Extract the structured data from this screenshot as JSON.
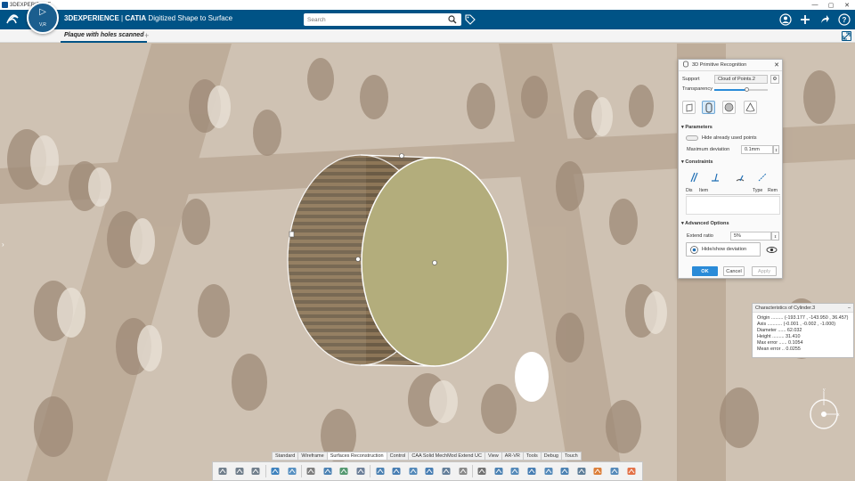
{
  "os": {
    "title": "3DEXPERIENCE",
    "controls": [
      "—",
      "▢",
      "✕"
    ]
  },
  "header": {
    "brand_bold": "3DEXPERIENCE",
    "brand_sep": " | ",
    "brand_app": "CATIA",
    "brand_role": " Digitized Shape to Surface",
    "compass_label": "V,R",
    "search_placeholder": "Search"
  },
  "tabs": {
    "active": "Plaque with holes scanned",
    "add": "+"
  },
  "panel": {
    "title": "3D Primitive Recognition",
    "support_label": "Support",
    "support_value": "Cloud of Points.2",
    "transparency_label": "Transparency",
    "transparency_value": 0.6,
    "parameters_label": "Parameters",
    "hide_used_label": "Hide already used points",
    "max_dev_label": "Maximum deviation",
    "max_dev_value": "0.1mm",
    "constraints_label": "Constraints",
    "table_headers": {
      "dis": "Dis",
      "item": "Item",
      "type": "Type",
      "rem": "Rem"
    },
    "advanced_label": "Advanced Options",
    "extend_label": "Extend ratio",
    "extend_value": "5%",
    "hide_show_label": "Hide/show deviation",
    "ok": "OK",
    "cancel": "Cancel",
    "apply": "Apply"
  },
  "characteristics": {
    "title": "Characteristics of Cylinder.3",
    "origin": "Origin ......... (-193.177 , -143.950 , 36.457)",
    "axis": "Axis ........... (-0.001 , -0.002 , -1.000)",
    "diameter": "Diameter ...... 62.032",
    "height": "Height ......... 31.410",
    "max_error": "Max error ...... 0.1054",
    "mean_error": "Mean error .. 0.0255"
  },
  "action_tabs": [
    "Standard",
    "Wireframe",
    "Surfaces Reconstruction",
    "Control",
    "CAA Solid MechMod Extend UC",
    "View",
    "AR-VR",
    "Tools",
    "Debug",
    "Touch"
  ],
  "active_action_tab": "Surfaces Reconstruction",
  "colors": {
    "header": "#005386",
    "accent": "#2a8bd8",
    "cylinder_face": "#b3ad7c"
  },
  "toolbar_icons": [
    "cut-icon",
    "copy-icon",
    "paste-icon",
    "undo-icon",
    "apply-appearance-icon",
    "settings-icon",
    "cloud-import-icon",
    "activate-icon",
    "mesh-icon",
    "scan-icon",
    "curve-icon",
    "surface-icon",
    "primitive-icon",
    "feature-recognition-icon",
    "snap-icon",
    "gear-icon",
    "project-icon",
    "align-icon",
    "offset-icon",
    "fill-icon",
    "cross-section-icon",
    "grid-icon",
    "analysis-icon",
    "deviation-icon",
    "color-map-icon"
  ]
}
